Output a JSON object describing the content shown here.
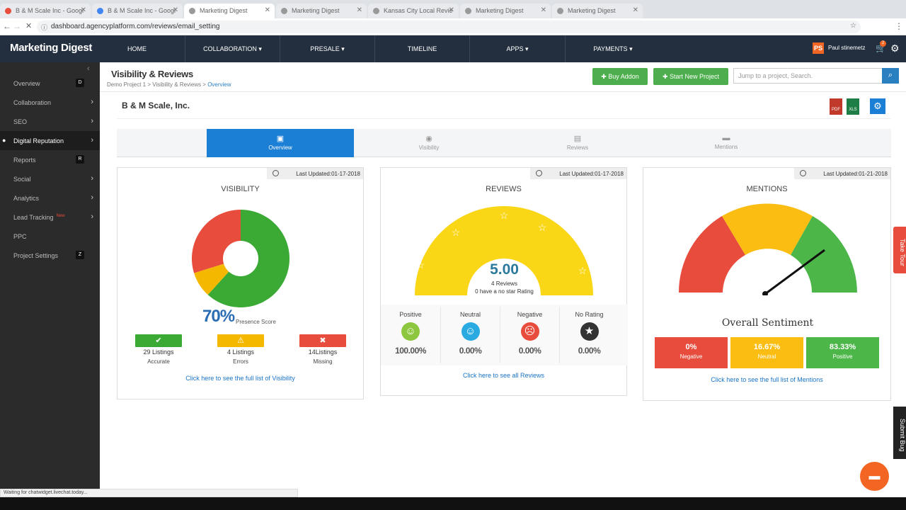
{
  "browser": {
    "tabs": [
      "B & M Scale Inc - Googl",
      "B & M Scale Inc - Googl",
      "Marketing Digest",
      "Marketing Digest",
      "Kansas City Local Revie",
      "Marketing Digest",
      "Marketing Digest"
    ],
    "url": "dashboard.agencyplatform.com/reviews/email_setting",
    "status": "Waiting for chatwidget.livechat.today..."
  },
  "header": {
    "brand": "Marketing Digest",
    "nav": [
      "HOME",
      "COLLABORATION ▾",
      "PRESALE ▾",
      "TIMELINE",
      "APPS ▾",
      "PAYMENTS ▾"
    ],
    "user_initials": "PS",
    "user_name": "Paul stinemetz",
    "cart_count": "2"
  },
  "sidebar": {
    "items": [
      {
        "label": "Overview",
        "key": "D"
      },
      {
        "label": "Collaboration"
      },
      {
        "label": "SEO"
      },
      {
        "label": "Digital Reputation"
      },
      {
        "label": "Reports",
        "key": "R"
      },
      {
        "label": "Social"
      },
      {
        "label": "Analytics"
      },
      {
        "label": "Lead Tracking",
        "badge": "New"
      },
      {
        "label": "PPC"
      },
      {
        "label": "Project Settings",
        "key": "Z"
      }
    ]
  },
  "page": {
    "title": "Visibility & Reviews",
    "breadcrumb": [
      "Demo Project 1",
      "Visibility & Reviews",
      "Overview"
    ],
    "buy_addon": "Buy Addon",
    "new_project": "Start New Project",
    "search_placeholder": "Jump to a project, Search.",
    "company": "B & M Scale, Inc.",
    "export_pdf": "PDF",
    "export_xls": "XLS"
  },
  "subtabs": [
    "Overview",
    "Visibility",
    "Reviews",
    "Mentions"
  ],
  "visibility": {
    "updated": "Last Updated:01-17-2018",
    "title": "VISIBILITY",
    "score": "70%",
    "score_label": "Presence Score",
    "stats": [
      {
        "count": "29 Listings",
        "label": "Accurate",
        "color": "#3aaa35",
        "icon": "✔"
      },
      {
        "count": "4 Listings",
        "label": "Errors",
        "color": "#f5b800",
        "icon": "⚠"
      },
      {
        "count": "14Listings",
        "label": "Missing",
        "color": "#e74c3c",
        "icon": "✖"
      }
    ],
    "link": "Click here to see the full list of Visibility",
    "chart": {
      "segments": [
        {
          "name": "Accurate",
          "value": 29,
          "color": "#3aaa35"
        },
        {
          "name": "Errors",
          "value": 4,
          "color": "#f5b800"
        },
        {
          "name": "Missing",
          "value": 14,
          "color": "#e74c3c"
        }
      ]
    }
  },
  "reviews": {
    "updated": "Last Updated:01-17-2018",
    "title": "REVIEWS",
    "rating": "5.00",
    "count_text": "4 Reviews",
    "norating_text": "0 have a no star Rating",
    "columns": [
      {
        "label": "Positive",
        "pct": "100.00%",
        "color": "#8dc63f",
        "icon": "☺"
      },
      {
        "label": "Neutral",
        "pct": "0.00%",
        "color": "#29abe2",
        "icon": "☺"
      },
      {
        "label": "Negative",
        "pct": "0.00%",
        "color": "#e74c3c",
        "icon": "☹"
      },
      {
        "label": "No Rating",
        "pct": "0.00%",
        "color": "#333333",
        "icon": "★"
      }
    ],
    "link": "Click here to see all Reviews"
  },
  "mentions": {
    "updated": "Last Updated:01-21-2018",
    "title": "MENTIONS",
    "sentiment_title": "Overall Sentiment",
    "boxes": [
      {
        "value": "0%",
        "label": "Negative",
        "color": "#e74c3c"
      },
      {
        "value": "16.67%",
        "label": "Neutral",
        "color": "#fbbd12"
      },
      {
        "value": "83.33%",
        "label": "Positive",
        "color": "#4cb748"
      }
    ],
    "link": "Click here to see the full list of Mentions"
  },
  "widgets": {
    "take_tour": "Take Tour",
    "submit_bug": "Submit Bug"
  }
}
